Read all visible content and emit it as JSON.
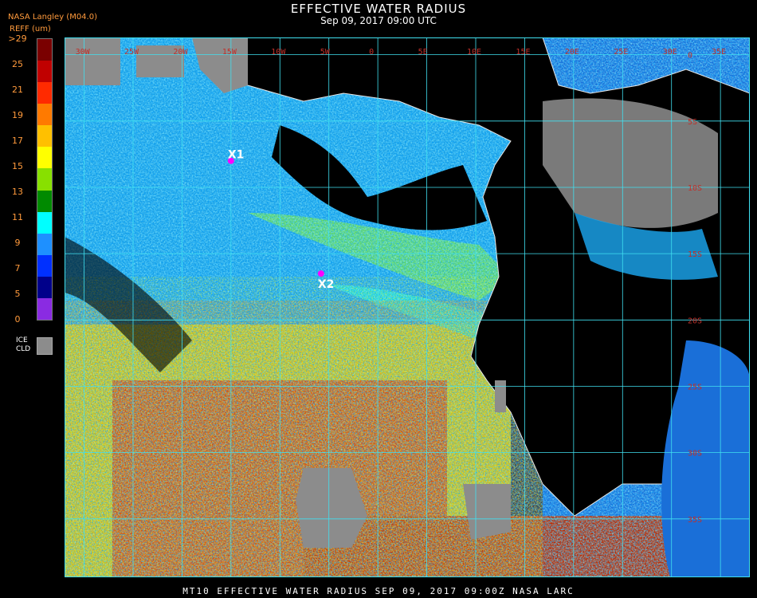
{
  "header": {
    "title": "EFFECTIVE WATER RADIUS",
    "subtitle": "Sep 09, 2017 09:00 UTC",
    "credit": "NASA Langley (M04.0)",
    "units": "REFF (um)"
  },
  "colorbar": {
    "labels": [
      ">29",
      "25",
      "21",
      "19",
      "17",
      "15",
      "13",
      "11",
      "9",
      "7",
      "5",
      "0"
    ],
    "colors": [
      "#7a0000",
      "#c00000",
      "#ff2a00",
      "#ff7a00",
      "#ffc000",
      "#ffff00",
      "#88e000",
      "#008a00",
      "#00ffff",
      "#1e90ff",
      "#0030ff",
      "#00008a",
      "#8a2be2"
    ],
    "ice_label_1": "ICE",
    "ice_label_2": "CLD",
    "ice_color": "#8c8c8c"
  },
  "map": {
    "lon_labels": [
      "30W",
      "25W",
      "20W",
      "15W",
      "10W",
      "5W",
      "0",
      "5E",
      "10E",
      "15E",
      "20E",
      "25E",
      "30E",
      "35E"
    ],
    "lat_labels": [
      "0",
      "5S",
      "10S",
      "15S",
      "20S",
      "25S",
      "30S",
      "35S"
    ],
    "markers": [
      {
        "label": "X1",
        "lon": -15.0,
        "lat": -8.0
      },
      {
        "label": "X2",
        "lon": -5.8,
        "lat": -16.5
      }
    ],
    "marker_color": "#ff00ff",
    "grid_color": "#40e0f0",
    "land_color": "#000000",
    "coast_color": "#ffffff"
  },
  "footer": {
    "text": "MT10  EFFECTIVE WATER RADIUS  SEP 09, 2017 09:00Z  NASA LARC"
  }
}
